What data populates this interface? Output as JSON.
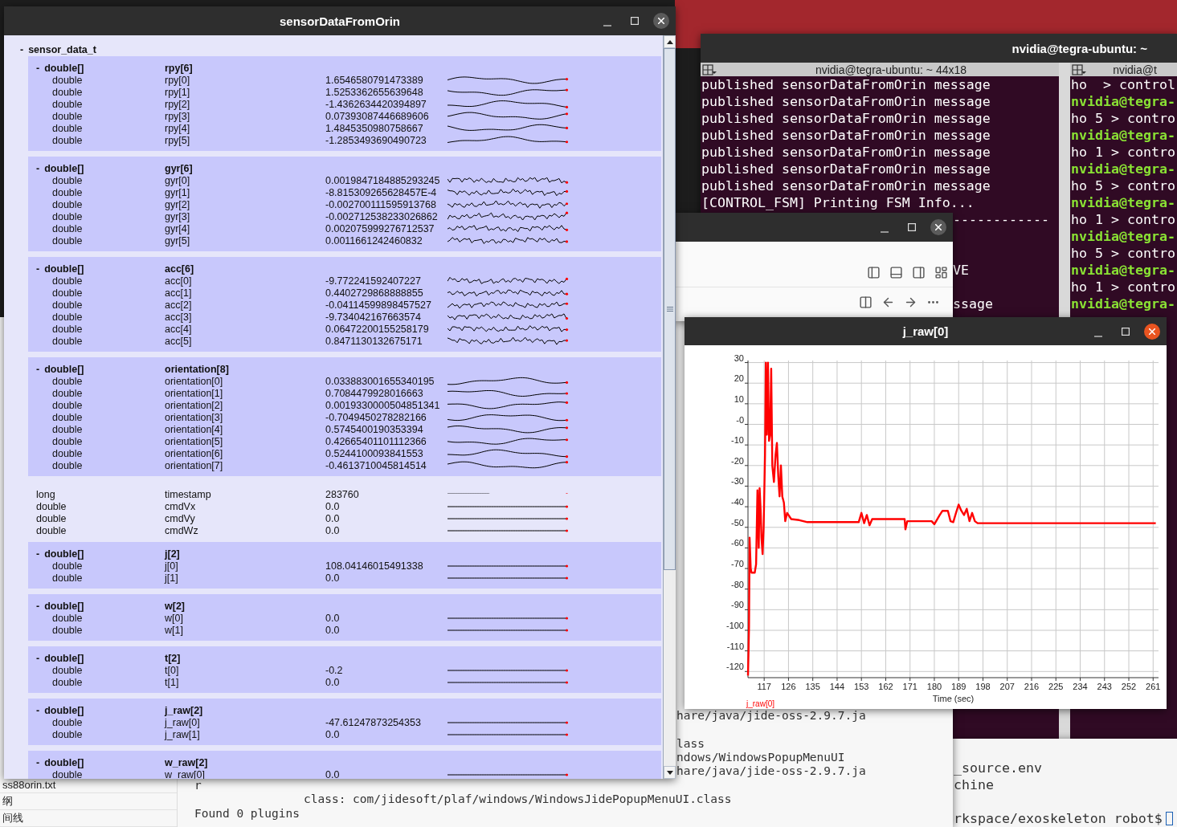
{
  "background_window": {
    "kind": "panel"
  },
  "main_window": {
    "title": "sensorDataFromOrin",
    "root": {
      "toggle": "-",
      "label": "sensor_data_t"
    },
    "groups": [
      {
        "kind": "array",
        "toggle": "-",
        "type": "double[]",
        "name": "rpy[6]",
        "items": [
          {
            "type": "double",
            "name": "rpy[0]",
            "value": "1.6546580791473389",
            "kind": "smooth"
          },
          {
            "type": "double",
            "name": "rpy[1]",
            "value": "1.5253362655639648",
            "kind": "smooth"
          },
          {
            "type": "double",
            "name": "rpy[2]",
            "value": "-1.4362634420394897",
            "kind": "smooth"
          },
          {
            "type": "double",
            "name": "rpy[3]",
            "value": "0.07393087446689606",
            "kind": "smooth"
          },
          {
            "type": "double",
            "name": "rpy[4]",
            "value": "1.4845350980758667",
            "kind": "smooth"
          },
          {
            "type": "double",
            "name": "rpy[5]",
            "value": "-1.2853493690490723",
            "kind": "smooth"
          }
        ]
      },
      {
        "kind": "array",
        "toggle": "-",
        "type": "double[]",
        "name": "gyr[6]",
        "items": [
          {
            "type": "double",
            "name": "gyr[0]",
            "value": "0.0019847184885293245",
            "kind": "noisy"
          },
          {
            "type": "double",
            "name": "gyr[1]",
            "value": "-8.815309265628457E-4",
            "kind": "noisy"
          },
          {
            "type": "double",
            "name": "gyr[2]",
            "value": "-0.002700111595913768",
            "kind": "noisy"
          },
          {
            "type": "double",
            "name": "gyr[3]",
            "value": "-0.002712538233026862",
            "kind": "noisy"
          },
          {
            "type": "double",
            "name": "gyr[4]",
            "value": "0.002075999276712537",
            "kind": "noisy"
          },
          {
            "type": "double",
            "name": "gyr[5]",
            "value": "0.0011661242460832",
            "kind": "noisy"
          }
        ]
      },
      {
        "kind": "array",
        "toggle": "-",
        "type": "double[]",
        "name": "acc[6]",
        "items": [
          {
            "type": "double",
            "name": "acc[0]",
            "value": "-9.772241592407227",
            "kind": "noisy"
          },
          {
            "type": "double",
            "name": "acc[1]",
            "value": "0.4402729868888855",
            "kind": "noisy"
          },
          {
            "type": "double",
            "name": "acc[2]",
            "value": "-0.04114599898457527",
            "kind": "noisy"
          },
          {
            "type": "double",
            "name": "acc[3]",
            "value": "-9.734042167663574",
            "kind": "noisy"
          },
          {
            "type": "double",
            "name": "acc[4]",
            "value": "0.06472200155258179",
            "kind": "noisy"
          },
          {
            "type": "double",
            "name": "acc[5]",
            "value": "0.8471130132675171",
            "kind": "noisy"
          }
        ]
      },
      {
        "kind": "array",
        "toggle": "-",
        "type": "double[]",
        "name": "orientation[8]",
        "items": [
          {
            "type": "double",
            "name": "orientation[0]",
            "value": "0.033883001655340195",
            "kind": "smooth"
          },
          {
            "type": "double",
            "name": "orientation[1]",
            "value": "0.7084479928016663",
            "kind": "smooth"
          },
          {
            "type": "double",
            "name": "orientation[2]",
            "value": "0.0019330000504851341",
            "kind": "smooth"
          },
          {
            "type": "double",
            "name": "orientation[3]",
            "value": "-0.7049450278282166",
            "kind": "smooth"
          },
          {
            "type": "double",
            "name": "orientation[4]",
            "value": "0.5745400190353394",
            "kind": "smooth"
          },
          {
            "type": "double",
            "name": "orientation[5]",
            "value": "0.42665401101112366",
            "kind": "smooth"
          },
          {
            "type": "double",
            "name": "orientation[6]",
            "value": "0.5244100093841553",
            "kind": "smooth"
          },
          {
            "type": "double",
            "name": "orientation[7]",
            "value": "-0.4613710045814514",
            "kind": "smooth"
          }
        ]
      },
      {
        "kind": "fields",
        "items": [
          {
            "type": "long",
            "name": "timestamp",
            "value": "283760",
            "kind": "step"
          },
          {
            "type": "double",
            "name": "cmdVx",
            "value": "0.0",
            "kind": "flat"
          },
          {
            "type": "double",
            "name": "cmdVy",
            "value": "0.0",
            "kind": "flat"
          },
          {
            "type": "double",
            "name": "cmdWz",
            "value": "0.0",
            "kind": "flat"
          }
        ]
      },
      {
        "kind": "array",
        "toggle": "-",
        "type": "double[]",
        "name": "j[2]",
        "items": [
          {
            "type": "double",
            "name": "j[0]",
            "value": "108.04146015491338",
            "kind": "flat"
          },
          {
            "type": "double",
            "name": "j[1]",
            "value": "0.0",
            "kind": "flat"
          }
        ]
      },
      {
        "kind": "array",
        "toggle": "-",
        "type": "double[]",
        "name": "w[2]",
        "items": [
          {
            "type": "double",
            "name": "w[0]",
            "value": "0.0",
            "kind": "flat"
          },
          {
            "type": "double",
            "name": "w[1]",
            "value": "0.0",
            "kind": "flat"
          }
        ]
      },
      {
        "kind": "array",
        "toggle": "-",
        "type": "double[]",
        "name": "t[2]",
        "items": [
          {
            "type": "double",
            "name": "t[0]",
            "value": "-0.2",
            "kind": "flat"
          },
          {
            "type": "double",
            "name": "t[1]",
            "value": "0.0",
            "kind": "flat"
          }
        ]
      },
      {
        "kind": "array",
        "toggle": "-",
        "type": "double[]",
        "name": "j_raw[2]",
        "items": [
          {
            "type": "double",
            "name": "j_raw[0]",
            "value": "-47.61247873254353",
            "kind": "flat"
          },
          {
            "type": "double",
            "name": "j_raw[1]",
            "value": "0.0",
            "kind": "flat"
          }
        ]
      },
      {
        "kind": "array",
        "toggle": "-",
        "type": "double[]",
        "name": "w_raw[2]",
        "items": [
          {
            "type": "double",
            "name": "w_raw[0]",
            "value": "0.0",
            "kind": "flat"
          }
        ]
      }
    ]
  },
  "editor": {
    "files": [
      "ss88orin.txt",
      "纲",
      "间线"
    ],
    "clipped_lines": [
      "hare/java/jide-oss-2.9.7.ja",
      "lass",
      "ndows/WindowsPopupMenuUI",
      "hare/java/jide-oss-2.9.7.ja"
    ],
    "lines": [
      {
        "kind": "plain",
        "text": "r"
      },
      {
        "kind": "indented",
        "text": "class: com/jidesoft/plaf/windows/WindowsJidePopupMenuUI.class"
      },
      {
        "kind": "plain",
        "text": "Found 0 plugins"
      }
    ]
  },
  "back_terminal": {
    "lines": [
      {
        "kind": "line",
        "text": "_source.env"
      },
      {
        "kind": "line",
        "text": "chine"
      },
      {
        "kind": "blank"
      },
      {
        "kind": "prompt",
        "text": "rkspace/exoskeleton robot$"
      }
    ]
  },
  "terminal": {
    "title": "nvidia@tegra-ubuntu: ~",
    "panes": [
      {
        "title": "nvidia@tegra-ubuntu: ~ 44x18",
        "lines": [
          {
            "kind": "line",
            "text": "published sensorDataFromOrin message"
          },
          {
            "kind": "line",
            "text": "published sensorDataFromOrin message"
          },
          {
            "kind": "line",
            "text": "published sensorDataFromOrin message"
          },
          {
            "kind": "line",
            "text": "published sensorDataFromOrin message"
          },
          {
            "kind": "line",
            "text": "published sensorDataFromOrin message"
          },
          {
            "kind": "line",
            "text": "published sensorDataFromOrin message"
          },
          {
            "kind": "line",
            "text": "published sensorDataFromOrin message"
          },
          {
            "kind": "line",
            "text": "[CONTROL_FSM] Printing FSM Info..."
          },
          {
            "kind": "cut",
            "text": "------------"
          },
          {
            "kind": "blank"
          },
          {
            "kind": "blank"
          },
          {
            "kind": "cut",
            "text": "VE"
          },
          {
            "kind": "blank"
          },
          {
            "kind": "cut",
            "text": "ssage"
          }
        ]
      },
      {
        "title": "nvidia@t",
        "lines": [
          {
            "kind": "line",
            "text": "ho  > control"
          },
          {
            "kind": "prompt",
            "text": "nvidia@tegra-"
          },
          {
            "kind": "line",
            "text": "ho 5 > contro"
          },
          {
            "kind": "prompt",
            "text": "nvidia@tegra-"
          },
          {
            "kind": "line",
            "text": "ho 1 > contro"
          },
          {
            "kind": "prompt",
            "text": "nvidia@tegra-"
          },
          {
            "kind": "line",
            "text": "ho 5 > contro"
          },
          {
            "kind": "prompt",
            "text": "nvidia@tegra-"
          },
          {
            "kind": "line",
            "text": "ho 1 > contro"
          },
          {
            "kind": "prompt",
            "text": "nvidia@tegra-"
          },
          {
            "kind": "line",
            "text": "ho 5 > contro"
          },
          {
            "kind": "prompt",
            "text": "nvidia@tegra-"
          },
          {
            "kind": "line",
            "text": "ho 1 > contro"
          },
          {
            "kind": "prompt",
            "text": "nvidia@tegra-"
          }
        ]
      }
    ]
  },
  "layout_window": {
    "kind": "toolbar"
  },
  "plot_window": {
    "title": "j_raw[0]",
    "chart_data": {
      "type": "line",
      "grid": true,
      "xlabel": "Time (sec)",
      "xlim": [
        111,
        263
      ],
      "ylim": [
        -123,
        31
      ],
      "xticks": [
        117,
        126,
        135,
        144,
        153,
        162,
        171,
        180,
        189,
        198,
        207,
        216,
        225,
        234,
        243,
        252,
        261
      ],
      "yticks": [
        30,
        20,
        10,
        {
          "value": 0,
          "label": "-0"
        },
        -10,
        -20,
        -30,
        -40,
        -50,
        -60,
        -70,
        -80,
        -90,
        -100,
        -110,
        -120
      ],
      "x": [
        111,
        111.2,
        111.4,
        111.6,
        112,
        112.3,
        113.5,
        114,
        114.5,
        115,
        115.3,
        115.7,
        116,
        116.4,
        116.8,
        117.3,
        117.6,
        118,
        118.4,
        118.8,
        119.2,
        119.6,
        120,
        120.6,
        121.2,
        121.7,
        122.2,
        122.7,
        123.2,
        123.7,
        124.3,
        124.8,
        125.5,
        127,
        130,
        133,
        152,
        153,
        154,
        155,
        156,
        157,
        165,
        169,
        169.3,
        170,
        179,
        180,
        182,
        183,
        185,
        186,
        187,
        188,
        189,
        190,
        191,
        192,
        193,
        194,
        195,
        196,
        262
      ],
      "series": [
        {
          "name": "j_raw[0]",
          "color": "#ff0000",
          "values": [
            -122,
            -110,
            -98,
            -55,
            -70,
            -72,
            -72,
            -68,
            -32,
            -60,
            -31,
            -42,
            -55,
            -63,
            -50,
            -15,
            30,
            -5,
            30,
            -8,
            -5,
            27,
            -20,
            -28,
            -15,
            -9,
            -25,
            -35,
            -20,
            -35,
            -38,
            -47,
            -43,
            -46,
            -46.5,
            -47.5,
            -47.5,
            -43,
            -48,
            -44,
            -49,
            -46,
            -46,
            -46,
            -51,
            -47,
            -47,
            -48.5,
            -44,
            -42,
            -42,
            -47,
            -47.5,
            -43,
            -39,
            -42,
            -44,
            -41,
            -47,
            -43,
            -47,
            -48,
            -48
          ]
        }
      ]
    }
  }
}
